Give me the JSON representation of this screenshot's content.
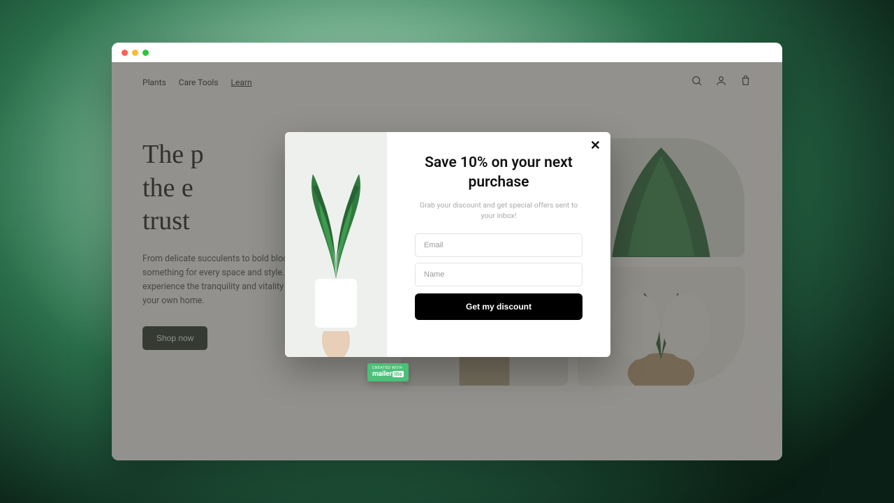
{
  "nav": {
    "items": [
      "Plants",
      "Care Tools",
      "Learn"
    ],
    "active_index": 2
  },
  "hero": {
    "title_line1": "The p",
    "title_line2": "the e",
    "title_line3": "trust",
    "subtitle": "From delicate succulents to bold blooms, we've got something for every space and style. Shop now and experience the tranquility and vitality of nature in your own home.",
    "cta": "Shop now"
  },
  "popup": {
    "title": "Save 10% on your next purchase",
    "subtitle": "Grab your discount and get special offers sent to your inbox!",
    "email_placeholder": "Email",
    "name_placeholder": "Name",
    "button": "Get my discount"
  },
  "badge": {
    "pretext": "CREATED WITH",
    "brand": "mailer",
    "suffix": "lite"
  }
}
